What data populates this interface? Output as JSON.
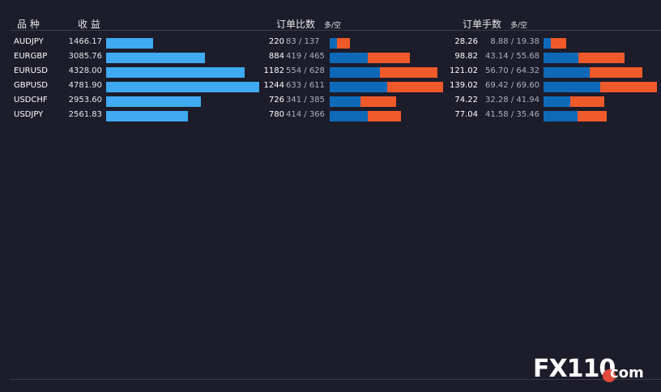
{
  "headers": {
    "symbol": "品 种",
    "profit": "收 益",
    "orders": "订单比数",
    "orders_sub": "多/空",
    "lots": "订单手数",
    "lots_sub": "多/空"
  },
  "colors": {
    "profit_bar": "#3fa9f2",
    "long": "#0e6ab8",
    "short": "#f0592a",
    "background": "#1c1c2a"
  },
  "rows": [
    {
      "symbol": "AUDJPY",
      "profit": "1466.17",
      "profit_value": 1466.17,
      "orders": "220",
      "orders_ratio": "83 / 137",
      "orders_long": 83,
      "orders_short": 137,
      "lots": "28.26",
      "lots_ratio": "8.88 / 19.38",
      "lots_long": 8.88,
      "lots_short": 19.38
    },
    {
      "symbol": "EURGBP",
      "profit": "3085.76",
      "profit_value": 3085.76,
      "orders": "884",
      "orders_ratio": "419 / 465",
      "orders_long": 419,
      "orders_short": 465,
      "lots": "98.82",
      "lots_ratio": "43.14 / 55.68",
      "lots_long": 43.14,
      "lots_short": 55.68
    },
    {
      "symbol": "EURUSD",
      "profit": "4328.00",
      "profit_value": 4328.0,
      "orders": "1182",
      "orders_ratio": "554 / 628",
      "orders_long": 554,
      "orders_short": 628,
      "lots": "121.02",
      "lots_ratio": "56.70 / 64.32",
      "lots_long": 56.7,
      "lots_short": 64.32
    },
    {
      "symbol": "GBPUSD",
      "profit": "4781.90",
      "profit_value": 4781.9,
      "orders": "1244",
      "orders_ratio": "633 / 611",
      "orders_long": 633,
      "orders_short": 611,
      "lots": "139.02",
      "lots_ratio": "69.42 / 69.60",
      "lots_long": 69.42,
      "lots_short": 69.6
    },
    {
      "symbol": "USDCHF",
      "profit": "2953.60",
      "profit_value": 2953.6,
      "orders": "726",
      "orders_ratio": "341 / 385",
      "orders_long": 341,
      "orders_short": 385,
      "lots": "74.22",
      "lots_ratio": "32.28 / 41.94",
      "lots_long": 32.28,
      "lots_short": 41.94
    },
    {
      "symbol": "USDJPY",
      "profit": "2561.83",
      "profit_value": 2561.83,
      "orders": "780",
      "orders_ratio": "414 / 366",
      "orders_long": 414,
      "orders_short": 366,
      "lots": "77.04",
      "lots_ratio": "41.58 / 35.46",
      "lots_long": 41.58,
      "lots_short": 35.46
    }
  ],
  "logo": {
    "text": "FX110",
    "suffix": "com"
  }
}
